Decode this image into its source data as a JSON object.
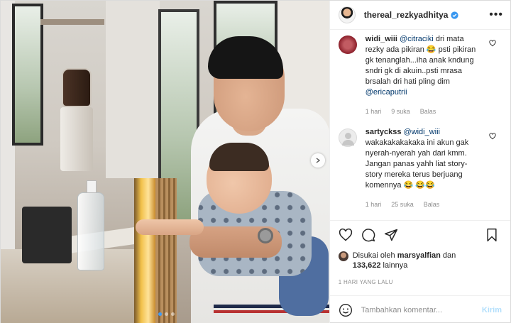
{
  "header": {
    "username": "thereal_rezkyadhitya",
    "verified": true,
    "more_icon": "more-horizontal-icon"
  },
  "comments": [
    {
      "username": "widi_wiii",
      "mention": "@citraciki",
      "text": " dri mata rezky ada pikiran 😂 psti pikiran gk tenanglah...iha anak kndung sndri gk di akuin..psti mrasa brsalah dri hati pling dim ",
      "mention2": "@ericaputrii",
      "time": "1 hari",
      "likes": "9 suka",
      "reply": "Balas"
    },
    {
      "username": "sartyckss",
      "mention": "@widi_wiii",
      "text": " wakakakakakaka ini akun gak nyerah-nyerah yah dari kmm. Jangan panas yahh liat story-story mereka terus berjuang komennya 😂 😂😂",
      "mention2": "",
      "time": "1 hari",
      "likes": "25 suka",
      "reply": "Balas"
    }
  ],
  "likes": {
    "prefix": "Disukai oleh ",
    "user": "marsyalfian",
    "middle": " dan ",
    "count": "133,622",
    "suffix": " lainnya"
  },
  "timestamp": "1 HARI YANG LALU",
  "add_comment": {
    "placeholder": "Tambahkan komentar...",
    "post_label": "Kirim"
  },
  "carousel": {
    "total_slides": 3,
    "active_slide": 1
  },
  "colors": {
    "mention": "#00376b",
    "verified": "#3897f0",
    "post_button": "#b2dffc",
    "muted": "#8e8e8e"
  }
}
